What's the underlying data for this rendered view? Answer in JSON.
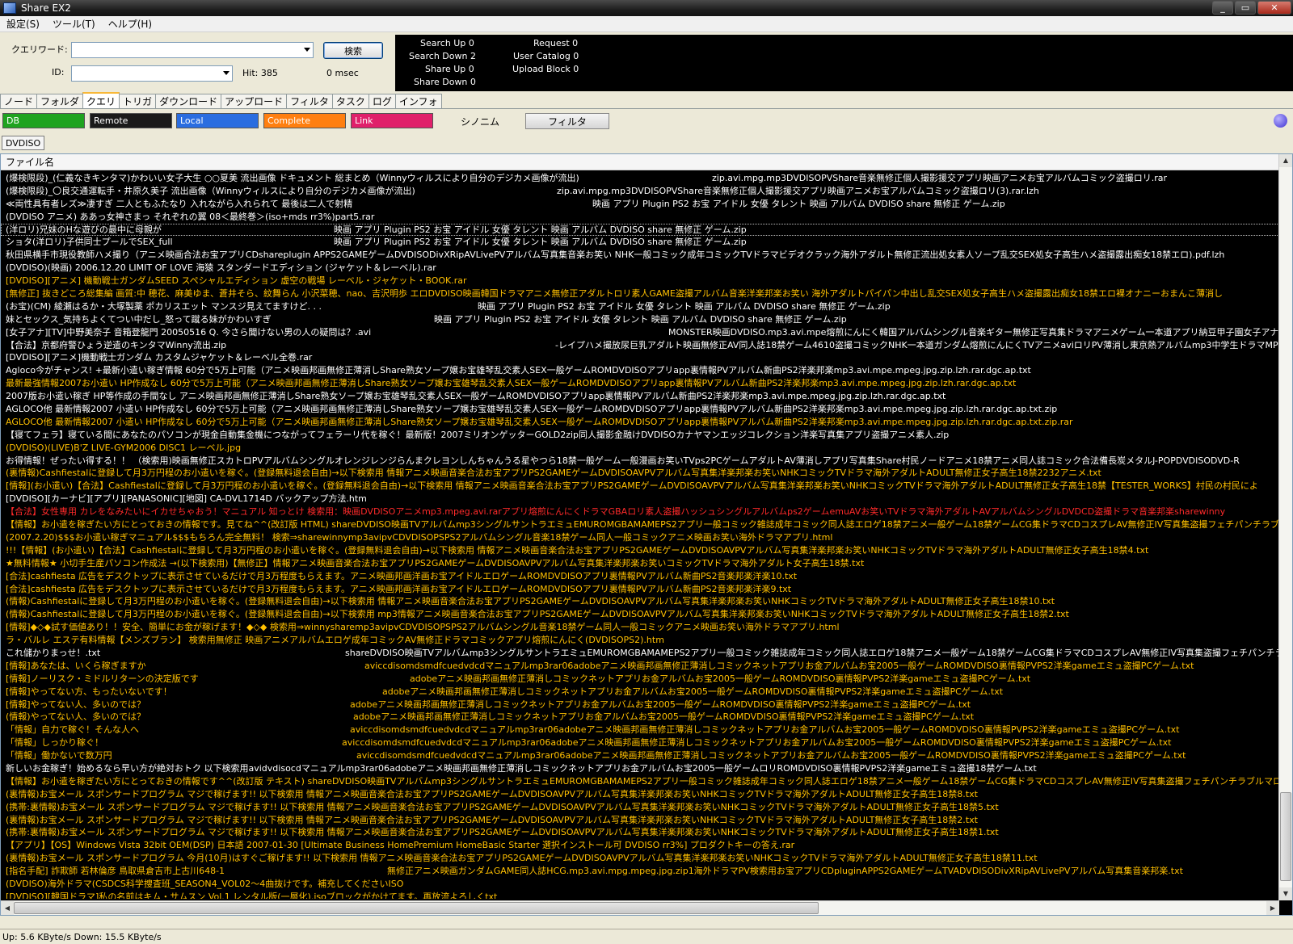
{
  "window": {
    "title": "Share EX2",
    "min": "_",
    "max": "▭",
    "close": "✕"
  },
  "menu": [
    "設定(S)",
    "ツール(T)",
    "ヘルプ(H)"
  ],
  "query": {
    "keyword_label": "クエリワード:",
    "id_label": "ID:",
    "search_button": "検索",
    "keyword_value": "",
    "id_value": "",
    "hit": "Hit: 385",
    "msec": "0 msec"
  },
  "stats": {
    "search_up": "Search Up  0",
    "search_down": "Search Down  2",
    "share_up": "Share Up  0",
    "share_down": "Share Down  0",
    "request": "Request  0",
    "user_catalog": "User Catalog  0",
    "upload_block": "Upload Block  0"
  },
  "tabs": [
    "ノード",
    "フォルダ",
    "クエリ",
    "トリガ",
    "ダウンロード",
    "アップロード",
    "フィルタ",
    "タスク",
    "ログ",
    "インフォ"
  ],
  "active_tab": "クエリ",
  "filters": {
    "chips": [
      {
        "label": "DB",
        "color": "#1fa31f"
      },
      {
        "label": "Remote",
        "color": "#1a1a1a"
      },
      {
        "label": "Local",
        "color": "#2a6de0"
      },
      {
        "label": "Complete",
        "color": "#ff7f10"
      },
      {
        "label": "Link",
        "color": "#e0206a"
      }
    ],
    "synonym": "シノニム",
    "filter_button": "フィルタ"
  },
  "keyword_tab": "DVDISO",
  "list": {
    "header": "ファイル名",
    "rows": [
      {
        "name": "(爆検限段)_(仁義なきキンタマ)かわいい女子大生 ○○夏美 流出画像 ドキュメント 総まとめ（Winnyウィルスにより自分のデジカメ画像が流出)",
        "ext": "zip.avi.mpg.mp3DVDISOPVShare音楽無修正個人撮影援交アプリ映画アニメお宝アルバムコミック盗撮ロリ.rar",
        "c": "w"
      },
      {
        "name": "(爆検限段)_〇良交通運転手・井原久美子 流出画像（Winnyウィルスにより自分のデジカメ画像が流出)",
        "ext": "zip.avi.mpg.mp3DVDISOPVShare音楽無修正個人撮影援交アプリ映画アニメお宝アルバムコミック盗撮ロリ(3).rar.lzh",
        "c": "w"
      },
      {
        "name": "≪両性具有者レズ≫凄すぎ 二人ともふたなり 入れながら入れられて 最後は二人で射精",
        "ext": "映画 アプリ Plugin PS2 お宝 アイドル 女優 タレント 映画 アルバム DVDISO share 無修正 ゲーム.zip",
        "c": "w"
      },
      {
        "name": "(DVDISO アニメ) ああっ女神さまっ それぞれの翼 08＜最終巻＞(iso+mds rr3%)part5.rar",
        "ext": "",
        "c": "w"
      },
      {
        "name": "(洋ロリ)兄妹のHな遊びの最中に母親が",
        "ext": "映画 アプリ Plugin PS2 お宝 アイドル 女優 タレント 映画 アルバム DVDISO share 無修正 ゲーム.zip",
        "c": "w",
        "sel": true
      },
      {
        "name": "ショタ(洋ロリ)子供同士プールでSEX_full",
        "ext": "映画 アプリ Plugin PS2 お宝 アイドル 女優 タレント 映画 アルバム DVDISO share 無修正 ゲーム.zip",
        "c": "w"
      },
      {
        "name": "秋田県横手市現役教師ハメ撮り（アニメ映画合法お宝アプリCDshareplugin APPS2GAMEゲームDVDISODivXRipAVLivePVアルバム写真集音楽お笑い NHK一般コミック成年コミックTVドラマビデオクラック海外アダルト無修正流出処女素人ソープ乱交SEX処女子高生ハメ盗撮露出痴女18禁エロ).pdf.lzh",
        "ext": "",
        "c": "w"
      },
      {
        "name": "(DVDISO)(映画) 2006.12.20 LIMIT OF LOVE 海猿 スタンダードエディション (ジャケット＆レーベル).rar",
        "ext": "",
        "c": "w"
      },
      {
        "name": "[DVDISO][アニメ] 機動戦士ガンダムSEED スペシャルエディション 虚空の戦場 レーベル・ジャケット・BOOK.rar",
        "ext": "",
        "c": "y"
      },
      {
        "name": "[無修正] 抜きどころ総集編 画質:中 穂花、麻美ゆま、蒼井そら、紋舞らん 小沢菜穂、nao、吉沢明歩 エロDVDISO映画韓国ドラマアニメ無修正アダルトロリ素人GAME盗撮アルバム音楽洋楽邦楽お笑い 海外アダルトパイパン中出し乱交SEX処女子高生ハメ盗撮露出痴女18禁エロ裸オナニーおまんこ薄消し",
        "ext": "",
        "c": "y"
      },
      {
        "name": "(お宝)(CM) 綾瀬はるか・大塚製薬 ポカリスエット マンスジ見えてますけど. . .",
        "ext": "映画 アプリ Plugin PS2 お宝 アイドル 女優 タレント 映画 アルバム DVDISO share 無修正 ゲーム.zip",
        "c": "w"
      },
      {
        "name": "妹とセックス_気持ちよくてつい中だし_怒って蹴る妹がかわいすぎ",
        "ext": "映画 アプリ Plugin PS2 お宝 アイドル 女優 タレント 映画 アルバム DVDISO share 無修正 ゲーム.zip",
        "c": "w"
      },
      {
        "name": "[女子アナ][TV]中野美奈子 音箱登龍門 20050516 Q. 今さら聞けない男の人の疑問は？.avi",
        "ext": "MONSTER映画DVDISO.mp3.avi.mpe熔煎にんにく韓国アルバムシングル音楽ギター無修正写真集ドラマアニメゲーム一本道アプリ納豆甲子園女子アナ",
        "c": "w"
      },
      {
        "name": "【合法】京都府警ひょう逆遣のキンタマWinny流出.zip",
        "ext": "-レイプハメ撮放尿巨乳アダルト映画無修正AV同人誌18禁ゲーム4610盗撮コミックNHK一本道ガンダム熔煎にんにくTVアニメaviロリPV薄消し東京熱アルバムmp3中学生ドラマMP3",
        "c": "w"
      },
      {
        "name": "[DVDISO][アニメ]機動戦士ガンダム カスタムジャケット＆レーベル全巻.rar",
        "ext": "",
        "c": "w"
      },
      {
        "name": "Agloco今がチャンス! +最新小遣い稼ぎ情報 60分で5万上可能（アニメ映画邦画無修正薄消しShare熟女ソープ嬢お宝雄琴乱交素人SEX一般ゲームROMDVDISOアプリapp裏情報PVアルバム新曲PS2洋楽邦楽mp3.avi.mpe.mpeg.jpg.zip.lzh.rar.dgc.ap.txt",
        "ext": "",
        "c": "w"
      },
      {
        "name": "最新最強情報2007お小遣い HP作成なし 60分で5万上可能（アニメ映画邦画無修正薄消しShare熟女ソープ嬢お宝雄琴乱交素人SEX一般ゲームROMDVDISOアプリapp裏情報PVアルバム新曲PS2洋楽邦楽mp3.avi.mpe.mpeg.jpg.zip.lzh.rar.dgc.ap.txt",
        "ext": "",
        "c": "y"
      },
      {
        "name": "2007版お小遣い稼ぎ HP等作成の手間なし アニメ映画邦画無修正薄消しShare熟女ソープ嬢お宝雄琴乱交素人SEX一般ゲームROMDVDISOアプリapp裏情報PVアルバム新曲PS2洋楽邦楽mp3.avi.mpe.mpeg.jpg.zip.lzh.rar.dgc.ap.txt",
        "ext": "",
        "c": "w"
      },
      {
        "name": "AGLOCO他 最新情報2007 小遣い HP作成なし 60分で5万上可能（アニメ映画邦画無修正薄消しShare熟女ソープ嬢お宝雄琴乱交素人SEX一般ゲームROMDVDISOアプリapp裏情報PVアルバム新曲PS2洋楽邦楽mp3.avi.mpe.mpeg.jpg.zip.lzh.rar.dgc.ap.txt.zip",
        "ext": "",
        "c": "w"
      },
      {
        "name": "AGLOCO他 最新情報2007 小遣い HP作成なし 60分で5万上可能（アニメ映画邦画無修正薄消しShare熟女ソープ嬢お宝雄琴乱交素人SEX一般ゲームROMDVDISOアプリapp裏情報PVアルバム新曲PS2洋楽邦楽mp3.avi.mpe.mpeg.jpg.zip.lzh.rar.dgc.ap.txt.zip.rar",
        "ext": "",
        "c": "y"
      },
      {
        "name": "【寝てフェラ】寝ている間にあなたのパソコンが現金自動集金機につながってフェラーリ代を稼ぐ！最新版！2007ミリオンゲッターGOLD2zip同人撮影金融けDVDISOカナヤマンエッジコレクション洋楽写真集アプリ盗撮アニメ素人.zip",
        "ext": "",
        "c": "w"
      },
      {
        "name": "(DVDISO)(LIVE)B'Z LIVE-GYM2006 DISC1 レーベル.jpg",
        "ext": "",
        "c": "y"
      },
      {
        "name": "お得情報！ぜったい得する！！ （検索用)映画無修正スカトロPVアルバムシングルオレンジレンジらんまクレヨンしんちゃんうる星やつら18禁一般ゲーム一般漫画お笑いTVps2PCゲームアダルトAV薄消しアプリ写真集Share村民ノードアニメ18禁アニメ同人誌コミック合法備長炭メタルJ-POPDVDISODVD-R",
        "ext": "",
        "c": "w"
      },
      {
        "name": "(裏情報)Cashfiestalに登録して月3万円程のお小遣いを稼ぐ。(登録無料退会自由)→以下検索用 情報アニメ映画音楽合法お宝アプリPS2GAMEゲームDVDISOAVPVアルバム写真集洋楽邦楽お笑いNHKコミックTVドラマ海外アダルトADULT無修正女子高生18禁2232アニメ.txt",
        "ext": "",
        "c": "y"
      },
      {
        "name": "[情報](お小遣い)【合法】Cashfiestalに登録して月3万円程のお小遣いを稼ぐ。(登録無料退会自由)→以下検索用 情報アニメ映画音楽合法お宝アプリPS2GAMEゲームDVDISOAVPVアルバム写真集洋楽邦楽お笑いNHKコミックTVドラマ海外アダルトADULT無修正女子高生18禁【TESTER_WORKS】村民の村民によ",
        "ext": "",
        "c": "y"
      },
      {
        "name": "[DVDISO][カーナビ][アプリ][PANASONIC][地図] CA-DVL1714D バックアップ方法.htm",
        "ext": "",
        "c": "w"
      },
      {
        "name": "【合法】女性専用 カレをなみたいにイカせちゃおう！マニュアル 知っとけ 検索用：映画DVDISOアニメmp3.mpeg.avi.rarアプリ熔煎にんにくドラマGBAロリ素人盗撮ハッシュシングルアルバムps2ゲームemuAVお笑いTVドラマ海外アダルトAVアルバムシングルDVDCD盗撮ドラマ音楽邦楽sharewinny",
        "ext": "",
        "c": "r"
      },
      {
        "name": "【情報】お小遣を稼ぎたい方にとっておきの情報です。見てね^^(改訂版 HTML) shareDVDISO映画TVアルバムmp3シングルサントラエミュEMUROMGBAMAMEPS2アプリ一般コミック雑誌成年コミック同人誌エロゲ18禁アニメ一般ゲーム18禁ゲームCG集ドラマCDコスプレAV無修正IV写真集盗撮フェチパンチラブル",
        "ext": "",
        "c": "y"
      },
      {
        "name": "(2007.2.20)$$$お小遣い稼ぎマニュアル$$$もちろん完全無料！ 検索⇒sharewinnymp3avipvCDVDISOPSPS2アルバムシングル音楽18禁ゲーム同人一般コミックアニメ映画お笑い海外ドラマアプリ.html",
        "ext": "",
        "c": "y"
      },
      {
        "name": "!!!【情報】(お小遣い)【合法】Cashfiestalに登録して月3万円程のお小遣いを稼ぐ。(登録無料退会自由)→以下検索用 情報アニメ映画音楽合法お宝アプリPS2GAMEゲームDVDISOAVPVアルバム写真集洋楽邦楽お笑いNHKコミックTVドラマ海外アダルトADULT無修正女子高生18禁4.txt",
        "ext": "",
        "c": "y"
      },
      {
        "name": "★無料情報★ 小切手生産パソコン作成法 →(以下検索用)【無修正】情報アニメ映画音楽合法お宝アプリPS2GAMEゲームDVDISOAVPVアルバム写真集洋楽邦楽お笑いコミックTVドラマ海外アダルト女子高生18禁.txt",
        "ext": "",
        "c": "y"
      },
      {
        "name": "[合法]cashfiesta 広告をデスクトップに表示させているだけで月3万程度もらえます。アニメ映画邦画洋画お宝アイドルエロゲームROMDVDISOアプリ裏情報PVアルバム新曲PS2音楽邦楽洋楽10.txt",
        "ext": "",
        "c": "y"
      },
      {
        "name": "[合法]cashfiesta 広告をデスクトップに表示させているだけで月3万程度もらえます。アニメ映画邦画洋画お宝アイドルエロゲームROMDVDISOアプリ裏情報PVアルバム新曲PS2音楽邦楽洋楽9.txt",
        "ext": "",
        "c": "y"
      },
      {
        "name": "(情報)Cashfiestalに登録して月3万円程のお小遣いを稼ぐ。(登録無料退会自由)→以下検索用 情報アニメ映画音楽合法お宝アプリPS2GAMEゲームDVDISOAVPVアルバム写真集洋楽邦楽お笑いNHKコミックTVドラマ海外アダルトADULT無修正女子高生18禁10.txt",
        "ext": "",
        "c": "y"
      },
      {
        "name": "(情報)Cashfiestalに登録して月3万円程のお小遣いを稼ぐ。(登録無料退会自由)→以下検索用 mp3情報アニメ映画音楽合法お宝アプリPS2GAMEゲームDVDISOAVPVアルバム写真集洋楽邦楽お笑いNHKコミックTVドラマ海外アダルトADULT無修正女子高生18禁2.txt",
        "ext": "",
        "c": "y"
      },
      {
        "name": "[情報]◆◇◆試す価値あり！！安全、簡単にお金が稼げます！◆◇◆ 検索用⇒winnysharemp3avipvCDVDISOPSPS2アルバムシングル音楽18禁ゲーム同人一般コミックアニメ映画お笑い海外ドラマアプリ.html",
        "ext": "",
        "c": "y"
      },
      {
        "name": "ラ・バルレ エステ有料情報【メンズブラン】 検索用無修正 映画アニメアルバムエロゲ成年コミックAV無修正ドラマコミックアプリ熔煎にんにく(DVDISOPS2).htm",
        "ext": "",
        "c": "y"
      },
      {
        "name": "これ儲かりまっせ！.txt",
        "ext": "shareDVDISO映画TVアルバムmp3シングルサントラエミュEMUROMGBAMAMEPS2アプリ一般コミック雑誌成年コミック同人誌エロゲ18禁アニメ一般ゲーム18禁ゲームCG集ドラマCDコスプレAV無修正IV写真集盗撮フェチパンチラ",
        "c": "w"
      },
      {
        "name": "[情報]あなたは、いくら稼ぎますか",
        "ext": "aviccdisomdsmdfcuedvdcdマニュアルmp3rar06adobeアニメ映画邦画無修正薄消しコミックネットアプリお金アルバムお宝2005一般ゲームROMDVDISO裏情報PVPS2洋楽gameエミュ盗撮PCゲーム.txt",
        "c": "y"
      },
      {
        "name": "[情報]ノーリスク・ミドルリターンの決定版です",
        "ext": "adobeアニメ映画邦画無修正薄消しコミックネットアプリお金アルバムお宝2005一般ゲームROMDVDISO裏情報PVPS2洋楽gameエミュ盗撮PCゲーム.txt",
        "c": "y"
      },
      {
        "name": "[情報]やってない方、もったいないです！",
        "ext": "adobeアニメ映画邦画無修正薄消しコミックネットアプリお金アルバムお宝2005一般ゲームROMDVDISO裏情報PVPS2洋楽gameエミュ盗撮PCゲーム.txt",
        "c": "y"
      },
      {
        "name": "[情報]やってない人、多いのでは？",
        "ext": "adobeアニメ映画邦画無修正薄消しコミックネットアプリお金アルバムお宝2005一般ゲームROMDVDISO裏情報PVPS2洋楽gameエミュ盗撮PCゲーム.txt",
        "c": "y"
      },
      {
        "name": "(情報)やってない人、多いのでは？",
        "ext": "adobeアニメ映画邦画無修正薄消しコミックネットアプリお金アルバムお宝2005一般ゲームROMDVDISO裏情報PVPS2洋楽gameエミュ盗撮PCゲーム.txt",
        "c": "y"
      },
      {
        "name": "「情報」自力で稼ぐ！そんな人へ",
        "ext": "aviccdisomdsmdfcuedvdcdマニュアルmp3rar06adobeアニメ映画邦画無修正薄消しコミックネットアプリお金アルバムお宝2005一般ゲームROMDVDISO裏情報PVPS2洋楽gameエミュ盗撮PCゲーム.txt",
        "c": "y"
      },
      {
        "name": "「情報」しっかり稼ぐ！",
        "ext": "aviccdisomdsmdfcuedvdcdマニュアルmp3rar06adobeアニメ映画邦画無修正薄消しコミックネットアプリお金アルバムお宝2005一般ゲームROMDVDISO裏情報PVPS2洋楽gameエミュ盗撮PCゲーム.txt",
        "c": "y"
      },
      {
        "name": "「情報」働かないで数万円",
        "ext": "aviccdisomdsmdfcuedvdcdマニュアルmp3rar06adobeアニメ映画邦画無修正薄消しコミックネットアプリお金アルバムお宝2005一般ゲームROMDVDISO裏情報PVPS2洋楽gameエミュ盗撮PCゲーム.txt",
        "c": "y"
      },
      {
        "name": "新しいお金稼ぎ！始めるなら早い方が絶対おトク 以下検索用avidvdisocdマニュアルmp3rar06adobeアニメ映画邦画無修正薄消しコミックネットアプリお金アルバムお宝2005一般ゲームロリROMDVDISO裏情報PVPS2洋楽gameエミュ盗撮18禁ゲーム.txt",
        "ext": "",
        "c": "w"
      },
      {
        "name": "【情報】お小遣を稼ぎたい方にとっておきの情報です^^(改訂版 テキスト) shareDVDISO映画TVアルバムmp3シングルサントラエミュEMUROMGBAMAMEPS2アプリ一般コミック雑誌成年コミック同人誌エロゲ18禁アニメ一般ゲーム18禁ゲームCG集ドラマCDコスプレAV無修正IV写真集盗撮フェチパンチラブルマロリ",
        "ext": "",
        "c": "y"
      },
      {
        "name": "(裏情報)お宝メール スポンサードプログラム マジで稼げます!! 以下検索用 情報アニメ映画音楽合法お宝アプリPS2GAMEゲームDVDISOAVPVアルバム写真集洋楽邦楽お笑いNHKコミックTVドラマ海外アダルトADULT無修正女子高生18禁8.txt",
        "ext": "",
        "c": "y"
      },
      {
        "name": "(携帯:裏情報)お宝メール スポンサードプログラム マジで稼げます!! 以下検索用 情報アニメ映画音楽合法お宝アプリPS2GAMEゲームDVDISOAVPVアルバム写真集洋楽邦楽お笑いNHKコミックTVドラマ海外アダルトADULT無修正女子高生18禁5.txt",
        "ext": "",
        "c": "y"
      },
      {
        "name": "(裏情報)お宝メール スポンサードプログラム マジで稼げます!! 以下検索用 情報アニメ映画音楽合法お宝アプリPS2GAMEゲームDVDISOAVPVアルバム写真集洋楽邦楽お笑いNHKコミックTVドラマ海外アダルトADULT無修正女子高生18禁2.txt",
        "ext": "",
        "c": "y"
      },
      {
        "name": "(携帯:裏情報)お宝メール スポンサードプログラム マジで稼げます!! 以下検索用 情報アニメ映画音楽合法お宝アプリPS2GAMEゲームDVDISOAVPVアルバム写真集洋楽邦楽お笑いNHKコミックTVドラマ海外アダルトADULT無修正女子高生18禁1.txt",
        "ext": "",
        "c": "y"
      },
      {
        "name": "【アプリ】【OS】Windows Vista 32bit OEM(DSP) 日本語 2007-01-30 [Ultimate Business HomePremium HomeBasic Starter 選択インストール可 DVDISO rr3%] プロダクトキーの答え.rar",
        "ext": "",
        "c": "y"
      },
      {
        "name": "(裏情報)お宝メール スポンサードプログラム 今月(10月)はすぐご稼げます!! 以下検索用 情報アニメ映画音楽合法お宝アプリPS2GAMEゲームDVDISOAVPVアルバム写真集洋楽邦楽お笑いNHKコミックTVドラマ海外アダルトADULT無修正女子高生18禁11.txt",
        "ext": "",
        "c": "y"
      },
      {
        "name": "[指名手配] 詐欺師 若林倫彦 鳥取県倉吉市上古川648-1",
        "ext": "無修正アニメ映画ガンダムGAME同人誌HCG.mp3.avi.mpg.mpeg.jpg.zip1海外ドラマPV検索用お宝アプリCDpluginAPPS2GAMEゲームTVADVDISODivXRipAVLivePVアルバム写真集音楽邦楽.txt",
        "c": "y"
      },
      {
        "name": "(DVDISO)海外ドラマ(CSDCS科学捜査班_SEASON4_VOL02～4曲抜けです。補充してくださいISO",
        "ext": "",
        "c": "y"
      },
      {
        "name": "[DVDISO][韓国ドラマ]私の名前はキム・サムスン Vol.1 レンタル版(一層化).isoブロックがかけてます。再放流よろしくtxt",
        "ext": "",
        "c": "y"
      }
    ]
  },
  "status": {
    "text": "Up: 5.6 KByte/s Down: 15.5 KByte/s"
  }
}
